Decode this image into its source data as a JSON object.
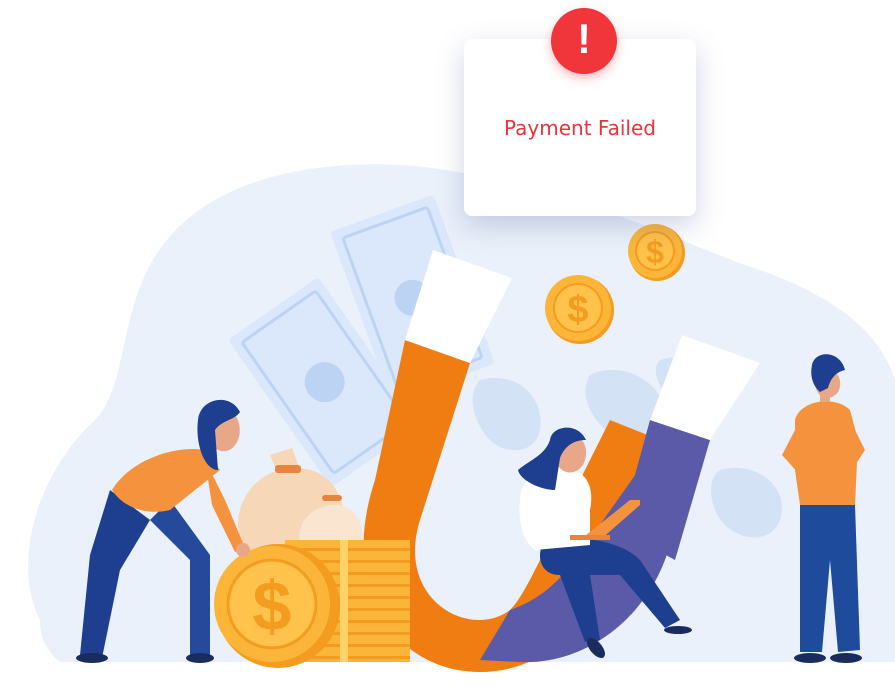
{
  "dialog": {
    "title": "Payment Failed",
    "alert_symbol": "!"
  },
  "icons": {
    "alert": "exclamation-icon",
    "coin": "dollar-coin-icon"
  },
  "colors": {
    "error": "#e8343a",
    "alert_badge": "#f0353b",
    "magnet_orange": "#f07d12",
    "magnet_purple": "#5a5aa8",
    "coin_gold": "#fbb63a",
    "backdrop": "#eaf1fa"
  }
}
